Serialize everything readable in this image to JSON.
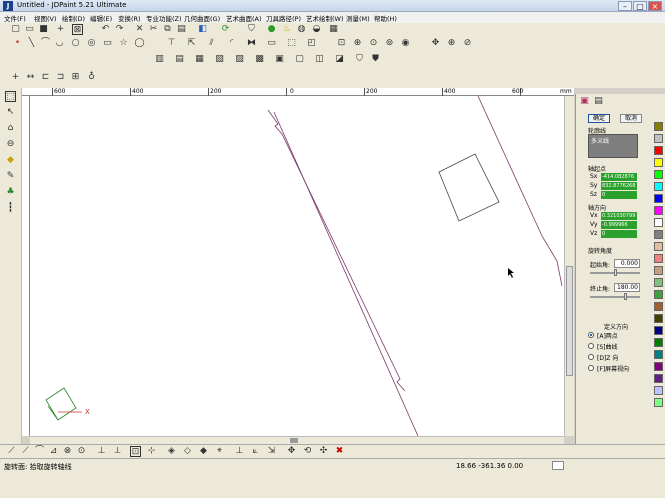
{
  "window": {
    "title": "Untitled - JDPaint 5.21 Ultimate",
    "icon_letter": "J",
    "min": "–",
    "max": "□",
    "close": "×"
  },
  "menu": [
    "文件(F)",
    "视图(V)",
    "绘制(D)",
    "编辑(E)",
    "变换(R)",
    "专业功能(Z)",
    "几何曲面(G)",
    "艺术曲面(A)",
    "刀具路径(P)",
    "艺术绘制(W)",
    "测量(M)",
    "帮助(H)"
  ],
  "ruler": {
    "top_labels": [
      "600",
      "400",
      "200",
      "0",
      "200",
      "400",
      "600"
    ],
    "unit": "mm"
  },
  "panel": {
    "confirm": "确定",
    "cancel": "取消",
    "section_curve": "轮廓线",
    "curve_type": "多义线",
    "section_origin": "轴起点",
    "sx_label": "Sx",
    "sx_value": "-414.082876",
    "sy_label": "Sy",
    "sy_value": "832.8776268",
    "sz_label": "Sz",
    "sz_value": "0",
    "section_dir": "轴方向",
    "vx_label": "Vx",
    "vx_value": "0.321030799",
    "vy_label": "Vy",
    "vy_value": "-0.999966",
    "vz_label": "Vz",
    "vz_value": "0",
    "section_angle": "旋转角度",
    "start_label": "起始角:",
    "start_value": "0.000",
    "end_label": "终止角:",
    "end_value": "180.00",
    "define_dir": "定义方向",
    "options": [
      "[A]两点",
      "[S]曲线",
      "[D]Z 向",
      "[F]屏幕视向"
    ],
    "selected_option": 0
  },
  "status": {
    "left": "旋转面: 拾取旋转轴线",
    "coords": "18.66  -361.36  0.00"
  },
  "palette_colors": [
    "#808000",
    "#c0c0c0",
    "#ff0000",
    "#ffff00",
    "#00ff00",
    "#00ffff",
    "#0000ff",
    "#ff00ff",
    "#ffffff",
    "#808080",
    "#e0c0a0",
    "#f08080",
    "#c0a080",
    "#80c080",
    "#40a040",
    "#a06030",
    "#404000",
    "#000080",
    "#008000",
    "#008080",
    "#800080",
    "#602080",
    "#c0c0ff",
    "#80ff80"
  ]
}
